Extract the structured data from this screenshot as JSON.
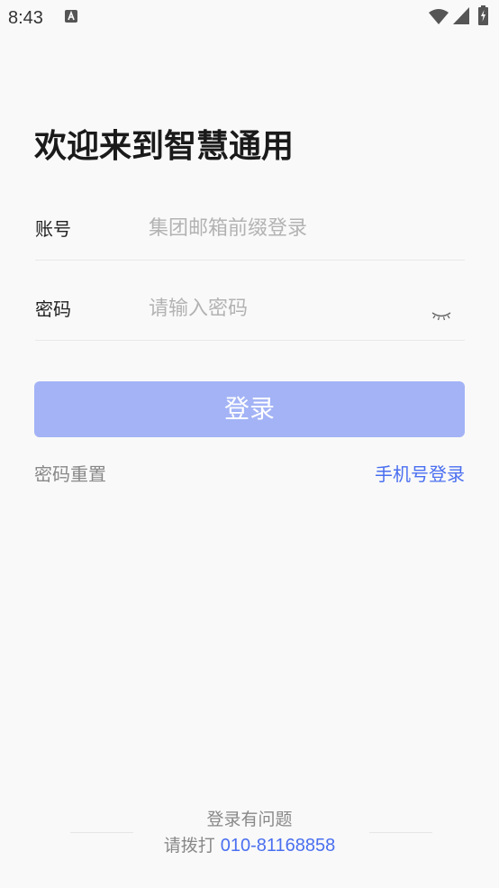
{
  "status_bar": {
    "time": "8:43",
    "icons": [
      "a-notification-icon",
      "wifi-icon",
      "cell-signal-icon",
      "battery-charging-icon"
    ]
  },
  "title": "欢迎来到智慧通用",
  "form": {
    "account": {
      "label": "账号",
      "value": "",
      "placeholder": "集团邮箱前缀登录"
    },
    "password": {
      "label": "密码",
      "value": "",
      "placeholder": "请输入密码",
      "toggle_icon": "eye-closed-icon"
    }
  },
  "login_button": {
    "label": "登录"
  },
  "links": {
    "reset_password": "密码重置",
    "phone_login": "手机号登录"
  },
  "footer": {
    "trouble": "登录有问题",
    "call_prefix": "请拨打",
    "phone": "010-81168858"
  },
  "colors": {
    "background": "#f9f9f9",
    "accent": "#4a6ff0",
    "button": "#a3b3f6",
    "muted_text": "#888888",
    "placeholder": "#b3b3b3"
  }
}
